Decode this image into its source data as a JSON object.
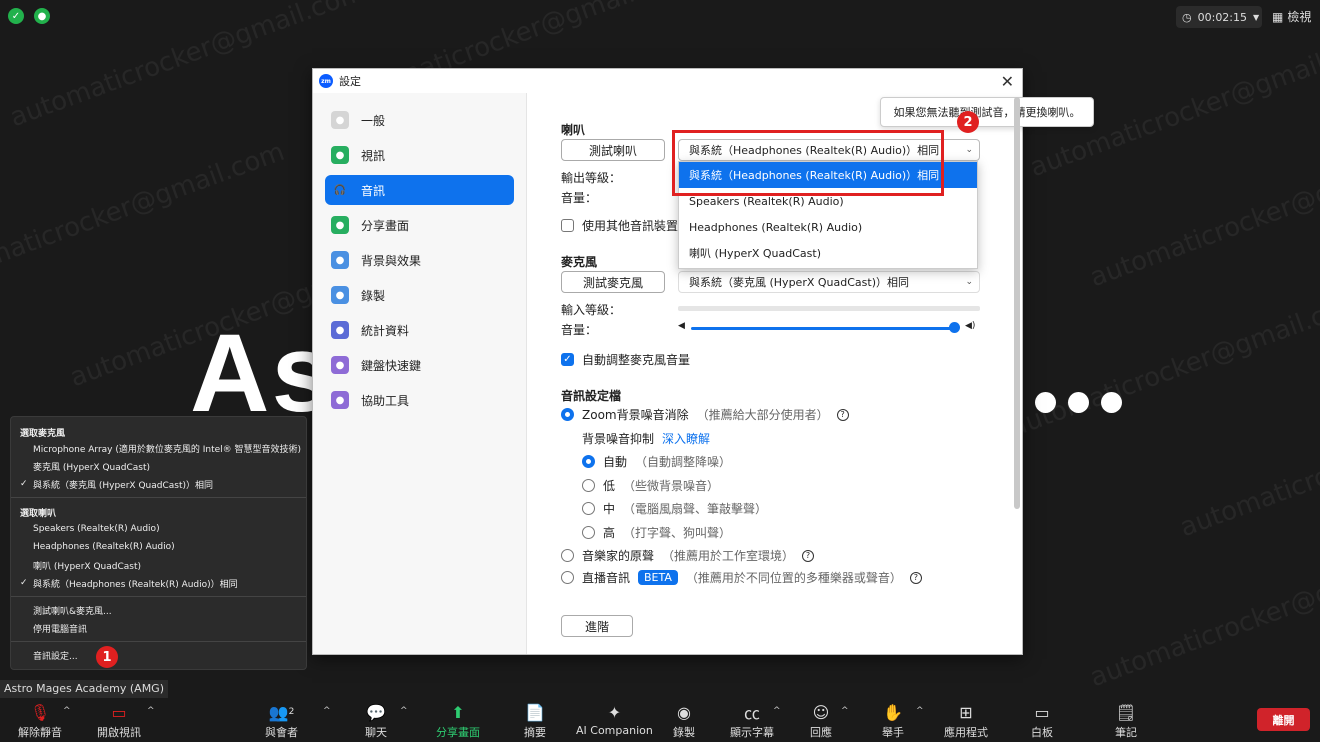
{
  "watermark": "automaticrocker@gmail.com",
  "topbar": {
    "timer": "00:02:15",
    "view_label": "檢視"
  },
  "participant_name": "As",
  "dialog": {
    "title": "設定",
    "nav": [
      {
        "label": "一般",
        "icon": "gear-icon",
        "color": "#d5d5d5"
      },
      {
        "label": "視訊",
        "icon": "camera-icon",
        "color": "#27ae60"
      },
      {
        "label": "音訊",
        "icon": "headphones-icon",
        "color": "#0e72ed"
      },
      {
        "label": "分享畫面",
        "icon": "share-screen-icon",
        "color": "#27ae60"
      },
      {
        "label": "背景與效果",
        "icon": "person-icon",
        "color": "#4a90e2"
      },
      {
        "label": "錄製",
        "icon": "record-icon",
        "color": "#4a90e2"
      },
      {
        "label": "統計資料",
        "icon": "stats-icon",
        "color": "#5b6bd6"
      },
      {
        "label": "鍵盤快速鍵",
        "icon": "keyboard-icon",
        "color": "#8e6bd6"
      },
      {
        "label": "協助工具",
        "icon": "accessibility-icon",
        "color": "#8e6bd6"
      }
    ],
    "speaker": {
      "title": "喇叭",
      "test_button": "測試喇叭",
      "tooltip": "如果您無法聽到測試音，請更換喇叭。",
      "selected": "與系統（Headphones (Realtek(R) Audio)）相同",
      "output_level": "輸出等級：",
      "volume": "音量："
    },
    "dropdown_options": [
      "與系統（Headphones (Realtek(R) Audio)）相同",
      "Speakers (Realtek(R) Audio)",
      "Headphones (Realtek(R) Audio)",
      "喇叭 (HyperX QuadCast)"
    ],
    "separate_device": "使用其他音訊裝置",
    "mic": {
      "title": "麥克風",
      "test_button": "測試麥克風",
      "selected": "與系統（麥克風 (HyperX QuadCast)）相同",
      "input_level": "輸入等級：",
      "volume": "音量："
    },
    "auto_adjust": "自動調整麥克風音量",
    "profile": {
      "title": "音訊設定檔",
      "zoom_bg": "Zoom背景噪音消除",
      "zoom_bg_hint": "（推薦給大部分使用者）",
      "suppression_label": "背景噪音抑制",
      "learn_more": "深入瞭解",
      "levels": [
        {
          "name": "自動",
          "hint": "（自動調整降噪）"
        },
        {
          "name": "低",
          "hint": "（些微背景噪音）"
        },
        {
          "name": "中",
          "hint": "（電腦風扇聲、筆敲擊聲）"
        },
        {
          "name": "高",
          "hint": "（打字聲、狗叫聲）"
        }
      ],
      "original_sound": "音樂家的原聲",
      "original_hint": "（推薦用於工作室環境）",
      "live_audio": "直播音訊",
      "beta": "BETA",
      "live_hint": "（推薦用於不同位置的多種樂器或聲音）"
    },
    "advanced_button": "進階"
  },
  "badges": [
    "1",
    "2"
  ],
  "audio_menu": {
    "mic_header": "選取麥克風",
    "mics": [
      {
        "label": "Microphone Array (適用於數位麥克風的 Intel® 智慧型音效技術)",
        "checked": false
      },
      {
        "label": "麥克風 (HyperX QuadCast)",
        "checked": false
      },
      {
        "label": "與系統（麥克風 (HyperX QuadCast)）相同",
        "checked": true
      }
    ],
    "speaker_header": "選取喇叭",
    "speakers": [
      {
        "label": "Speakers (Realtek(R) Audio)",
        "checked": false
      },
      {
        "label": "Headphones (Realtek(R) Audio)",
        "checked": false
      },
      {
        "label": "喇叭 (HyperX QuadCast)",
        "checked": false
      },
      {
        "label": "與系統（Headphones (Realtek(R) Audio)）相同",
        "checked": true
      }
    ],
    "test": "測試喇叭&麥克風...",
    "leave_audio": "停用電腦音訊",
    "settings": "音訊設定..."
  },
  "meeting_name": "Astro Mages Academy (AMG)",
  "toolbar": {
    "unmute": "解除靜音",
    "start_video": "開啟視訊",
    "participants": "與會者",
    "participants_count": "2",
    "chat": "聊天",
    "share": "分享畫面",
    "summary": "摘要",
    "ai": "AI Companion",
    "record": "錄製",
    "captions": "顯示字幕",
    "reactions": "回應",
    "raise_hand": "舉手",
    "apps": "應用程式",
    "whiteboard": "白板",
    "notes": "筆記",
    "leave": "離開"
  }
}
